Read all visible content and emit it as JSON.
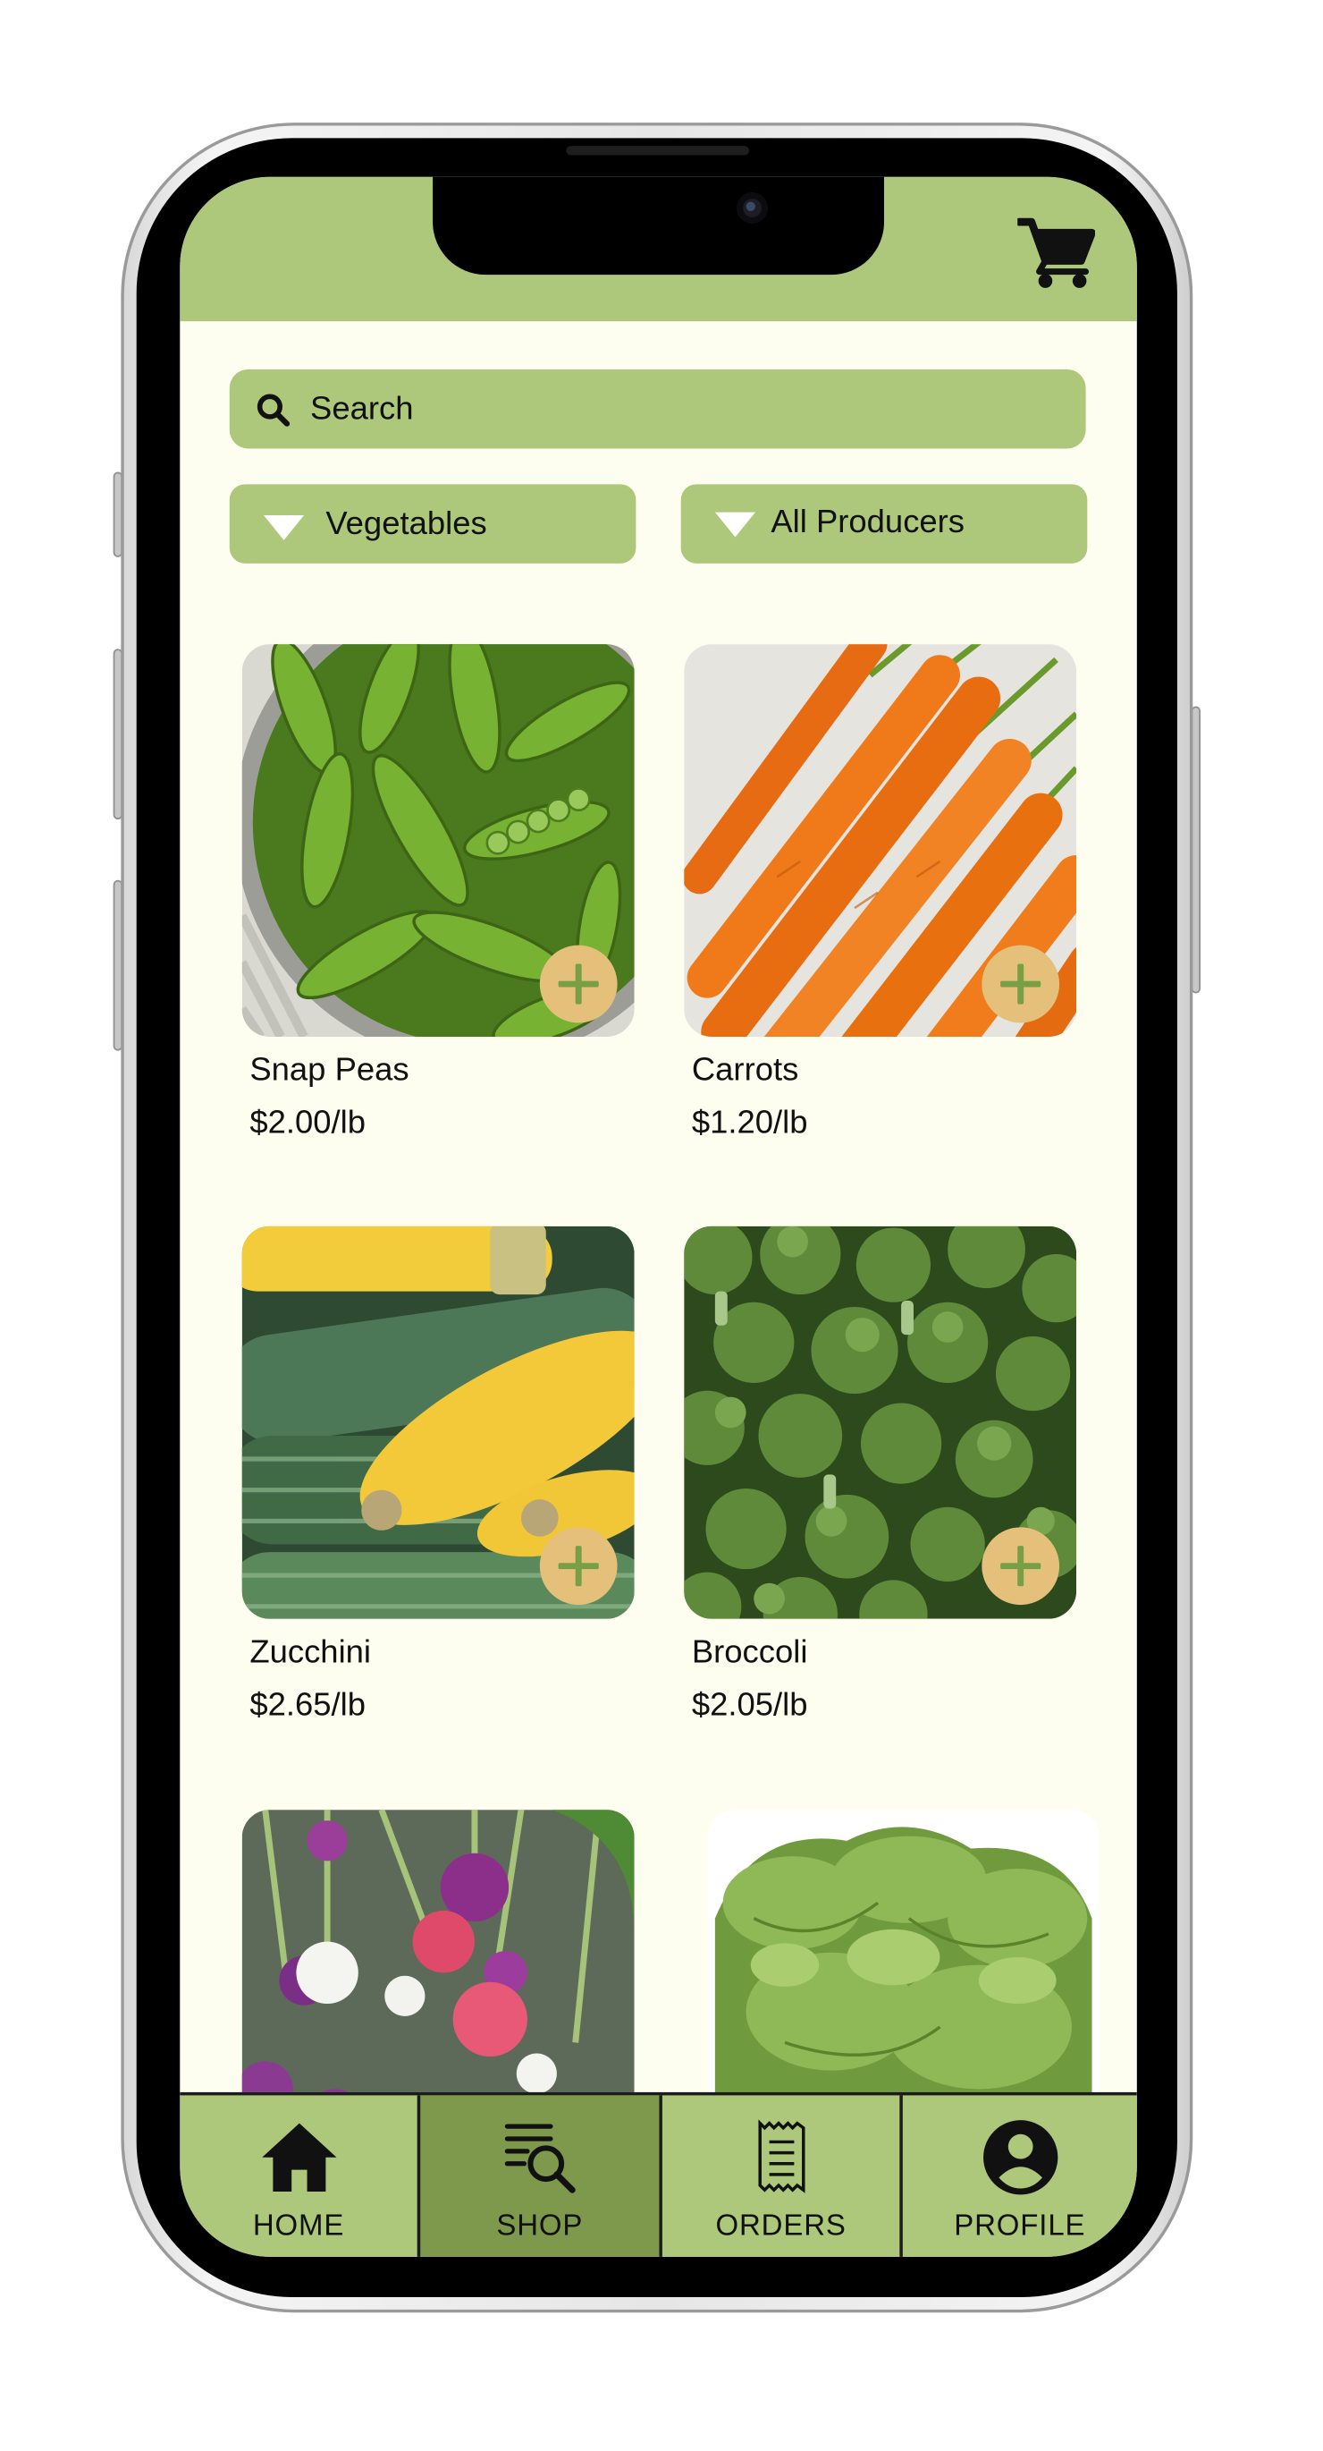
{
  "search": {
    "placeholder": "Search"
  },
  "filters": {
    "category": "Vegetables",
    "producer": "All Producers"
  },
  "products": [
    {
      "name": "Snap Peas",
      "price": "$2.00/lb"
    },
    {
      "name": "Carrots",
      "price": "$1.20/lb"
    },
    {
      "name": "Zucchini",
      "price": "$2.65/lb"
    },
    {
      "name": "Broccoli",
      "price": "$2.05/lb"
    },
    {
      "name": "",
      "price": ""
    },
    {
      "name": "",
      "price": ""
    }
  ],
  "nav": {
    "tabs": [
      {
        "label": "HOME",
        "icon": "home-icon",
        "active": false
      },
      {
        "label": "SHOP",
        "icon": "shop-search-icon",
        "active": true
      },
      {
        "label": "ORDERS",
        "icon": "receipt-icon",
        "active": false
      },
      {
        "label": "PROFILE",
        "icon": "profile-icon",
        "active": false
      }
    ]
  },
  "colors": {
    "header_green": "#adc77b",
    "active_tab_green": "#7f994c",
    "screen_background": "#fdfef0",
    "add_button_fill": "#e4c07b",
    "add_button_plus": "#789f45"
  }
}
